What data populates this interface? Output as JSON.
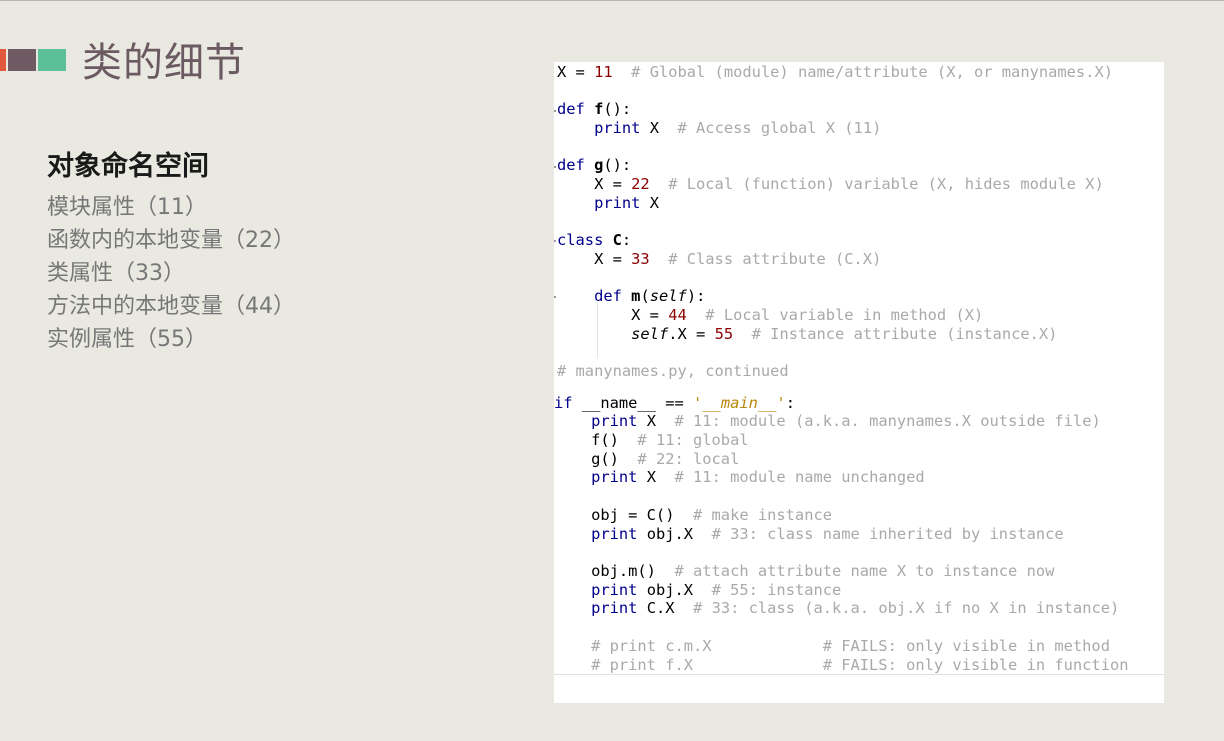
{
  "slide": {
    "title": "类的细节",
    "subtitle": "对象命名空间",
    "items": [
      "模块属性（11）",
      "函数内的本地变量（22）",
      "类属性（33）",
      "方法中的本地变量（44）",
      "实例属性（55）"
    ]
  },
  "code": {
    "lines": [
      [
        [
          "X = ",
          ""
        ],
        [
          "11",
          "num"
        ],
        [
          "  # Global (module) name/attribute (X, or manynames.X)",
          "comment"
        ]
      ],
      [],
      [
        [
          "def",
          "kw"
        ],
        [
          " ",
          ""
        ],
        [
          "f",
          "bold"
        ],
        [
          "():",
          ""
        ]
      ],
      [
        [
          "    ",
          ""
        ],
        [
          "print",
          "kw"
        ],
        [
          " X  ",
          ""
        ],
        [
          "# Access global X (11)",
          "comment"
        ]
      ],
      [],
      [
        [
          "def",
          "kw"
        ],
        [
          " ",
          ""
        ],
        [
          "g",
          "bold"
        ],
        [
          "():",
          ""
        ]
      ],
      [
        [
          "    X = ",
          ""
        ],
        [
          "22",
          "num"
        ],
        [
          "  # Local (function) variable (X, hides module X)",
          "comment"
        ]
      ],
      [
        [
          "    ",
          ""
        ],
        [
          "print",
          "kw"
        ],
        [
          " X",
          ""
        ]
      ],
      [],
      [
        [
          "class",
          "kw"
        ],
        [
          " ",
          ""
        ],
        [
          "C",
          "bold"
        ],
        [
          ":",
          ""
        ]
      ],
      [
        [
          "    X = ",
          ""
        ],
        [
          "33",
          "num"
        ],
        [
          "  # Class attribute (C.X)",
          "comment"
        ]
      ],
      [],
      [
        [
          "    ",
          ""
        ],
        [
          "def",
          "kw"
        ],
        [
          " ",
          ""
        ],
        [
          "m",
          "bold"
        ],
        [
          "(",
          ""
        ],
        [
          "self",
          "self"
        ],
        [
          "):",
          ""
        ]
      ],
      [
        [
          "        X = ",
          ""
        ],
        [
          "44",
          "num"
        ],
        [
          "  # Local variable in method (X)",
          "comment"
        ]
      ],
      [
        [
          "        ",
          ""
        ],
        [
          "self",
          "self"
        ],
        [
          ".X = ",
          ""
        ],
        [
          "55",
          "num"
        ],
        [
          "  # Instance attribute (instance.X)",
          "comment"
        ]
      ],
      [],
      [
        [
          "# manynames.py, continued",
          "comment"
        ]
      ],
      [],
      [
        [
          "if",
          "kw"
        ],
        [
          " __name__ == ",
          ""
        ],
        [
          "'__main__'",
          "str"
        ],
        [
          ":",
          ""
        ]
      ],
      [
        [
          "    ",
          ""
        ],
        [
          "print",
          "kw"
        ],
        [
          " X  ",
          ""
        ],
        [
          "# 11: module (a.k.a. manynames.X outside file)",
          "comment"
        ]
      ],
      [
        [
          "    f()  ",
          ""
        ],
        [
          "# 11: global",
          "comment"
        ]
      ],
      [
        [
          "    g()  ",
          ""
        ],
        [
          "# 22: local",
          "comment"
        ]
      ],
      [
        [
          "    ",
          ""
        ],
        [
          "print",
          "kw"
        ],
        [
          " X  ",
          ""
        ],
        [
          "# 11: module name unchanged",
          "comment"
        ]
      ],
      [],
      [
        [
          "    obj = C()  ",
          ""
        ],
        [
          "# make instance",
          "comment"
        ]
      ],
      [
        [
          "    ",
          ""
        ],
        [
          "print",
          "kw"
        ],
        [
          " obj.X  ",
          ""
        ],
        [
          "# 33: class name inherited by instance",
          "comment"
        ]
      ],
      [],
      [
        [
          "    obj.m()  ",
          ""
        ],
        [
          "# attach attribute name X to instance now",
          "comment"
        ]
      ],
      [
        [
          "    ",
          ""
        ],
        [
          "print",
          "kw"
        ],
        [
          " obj.X  ",
          ""
        ],
        [
          "# 55: instance",
          "comment"
        ]
      ],
      [
        [
          "    ",
          ""
        ],
        [
          "print",
          "kw"
        ],
        [
          " C.X  ",
          ""
        ],
        [
          "# 33: class (a.k.a. obj.X if no X in instance)",
          "comment"
        ]
      ],
      [],
      [
        [
          "    # print c.m.X            # FAILS: only visible in method",
          "comment"
        ]
      ],
      [
        [
          "    # print f.X              # FAILS: only visible in function",
          "comment"
        ]
      ]
    ]
  }
}
